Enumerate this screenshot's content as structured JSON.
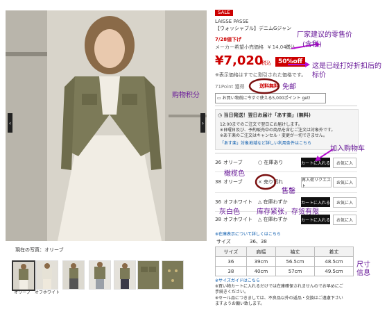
{
  "product": {
    "sale_badge": "SALE",
    "brand": "LAISSE PASSE",
    "name": "【ウォッシャブル】デニムGジャン",
    "date_label": "7/28値下げ",
    "list_price_label": "メーカー希望小売価格",
    "list_price": "¥ 14,040",
    "list_price_tax": "税込",
    "price": "¥7,020",
    "price_tax": "税込",
    "discount": "50%off",
    "tax_note": "※表示価格はすでに割引された価格です。",
    "points_label": "71Point 獲得",
    "free_shipping": "送料無料",
    "points_promo": "お買い物前に今すぐ使える5,000ポイント get!"
  },
  "delivery": {
    "title": "当日発送！翌日お届け「あす楽」(無料)",
    "line1": "12:00までのご注文で翌日にお届けします。",
    "line2": "※日曜日及び、予約販売中の商品を含むご注文は対象外です。",
    "line3": "※あす楽のご注文はキャンセル・変更が一切できません。",
    "link": "「あす楽」対象地域など詳しい利用条件はこちら"
  },
  "variants": [
    {
      "size": "36",
      "color": "オリーブ",
      "status": "在庫あり",
      "action": "カートに入れる",
      "fav": "お気に入"
    },
    {
      "size": "38",
      "color": "オリーブ",
      "status": "売り切れ",
      "action": "再入荷リクエスト",
      "fav": "お気に入"
    },
    {
      "size": "36",
      "color": "オフホワイト",
      "status": "在庫わずか",
      "action": "カートに入れる",
      "fav": "お気に入"
    },
    {
      "size": "38",
      "color": "オフホワイト",
      "status": "在庫わずか",
      "action": "カートに入れる",
      "fav": "お気に入"
    }
  ],
  "stock_note": "※在庫表示について詳しくはこちら",
  "sizes": {
    "label": "サイズ",
    "values": "36、38",
    "headers": [
      "サイズ",
      "肩幅",
      "袖丈",
      "着丈"
    ],
    "rows": [
      [
        "36",
        "39cm",
        "56.5cm",
        "48.5cm"
      ],
      [
        "38",
        "40cm",
        "57cm",
        "49.5cm"
      ]
    ],
    "guide": "※サイズガイドはこちら",
    "footer1": "※買い物カートに入れるだけでは在庫確保されませんのでお早めにご",
    "footer2": "手続きください。",
    "footer3": "※セール品につきましては、不良品以外の返品・交換はご遠慮下さい",
    "footer4": "ますようお願い致します。"
  },
  "gallery": {
    "caption": "現在の写真：オリーブ",
    "thumb_labels": [
      "オリーブ",
      "オフホワイト"
    ]
  },
  "annotations": {
    "retail_price": "厂家建议的零售价",
    "retail_price_sub": "(含税)",
    "discount_price": "这是已经打好折扣后的",
    "discount_price_sub": "标价",
    "free_shipping": "免邮",
    "points": "购物积分",
    "add_to_cart": "加入购物车",
    "olive": "橄榄色",
    "sold_out": "售罄",
    "off_white": "灰白色",
    "low_stock": "库存紧张，存货有限",
    "size_info": "尺寸",
    "size_info2": "信息"
  },
  "colors": {
    "accent_red": "#cc0000",
    "annotation": "#6a1b9a",
    "marker": "#7a1010"
  }
}
